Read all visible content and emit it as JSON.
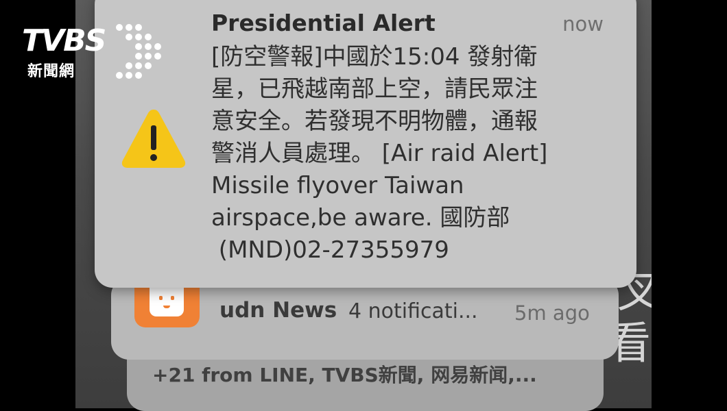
{
  "logo": {
    "brand": "TVBS",
    "subtitle": "新聞網"
  },
  "alert": {
    "title": "Presidential Alert",
    "time": "now",
    "icon": "warning-triangle-icon",
    "icon_color": "#f5c518",
    "lines": [
      "[防空警報]中國於15:04 發射衛",
      "星，已飛越南部上空，請民眾注",
      "意安全。若發現不明物體，通報",
      "警消人員處理。 [Air raid Alert]",
      "Missile flyover Taiwan",
      "airspace,be aware. 國防部",
      " (MND)02-27355979"
    ]
  },
  "udn": {
    "icon": "udn-app-icon",
    "icon_color": "#f08135",
    "app": "udn News",
    "count": "4 notificati...",
    "time": "5m ago"
  },
  "more": {
    "text": "+21 from LINE, TVBS新聞, 网易新闻,..."
  },
  "background": {
    "scribble_1": "叉",
    "scribble_2": "看"
  }
}
